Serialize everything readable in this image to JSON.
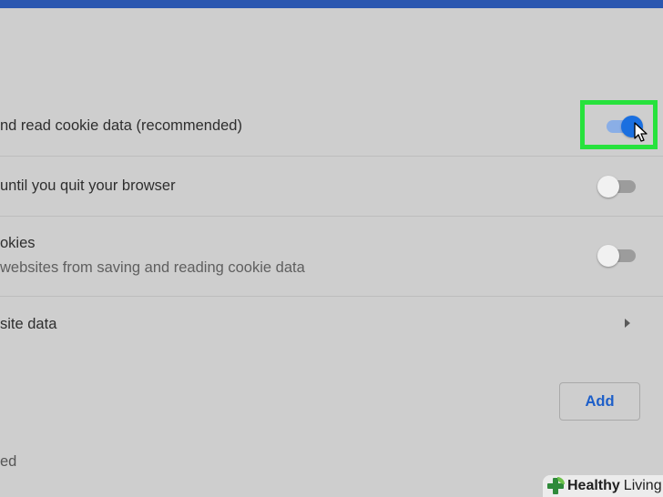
{
  "settings": {
    "rows": [
      {
        "label": "nd read cookie data (recommended)",
        "toggle": true
      },
      {
        "label": "until you quit your browser",
        "toggle": false
      },
      {
        "label": "okies",
        "sublabel": "websites from saving and reading cookie data",
        "toggle": false
      },
      {
        "label": "site data"
      }
    ],
    "add_label": "Add",
    "bottom_fragment": "ed"
  },
  "watermark": {
    "brand_part1": "Healthy",
    "brand_part2": "Living"
  },
  "colors": {
    "accent": "#1a6fe0",
    "highlight": "#27e23d",
    "topbar": "#2b57b0",
    "background": "#cecece"
  },
  "icons": [
    "cursor-arrow-icon",
    "chevron-right-icon",
    "healthy-living-logo-icon"
  ]
}
